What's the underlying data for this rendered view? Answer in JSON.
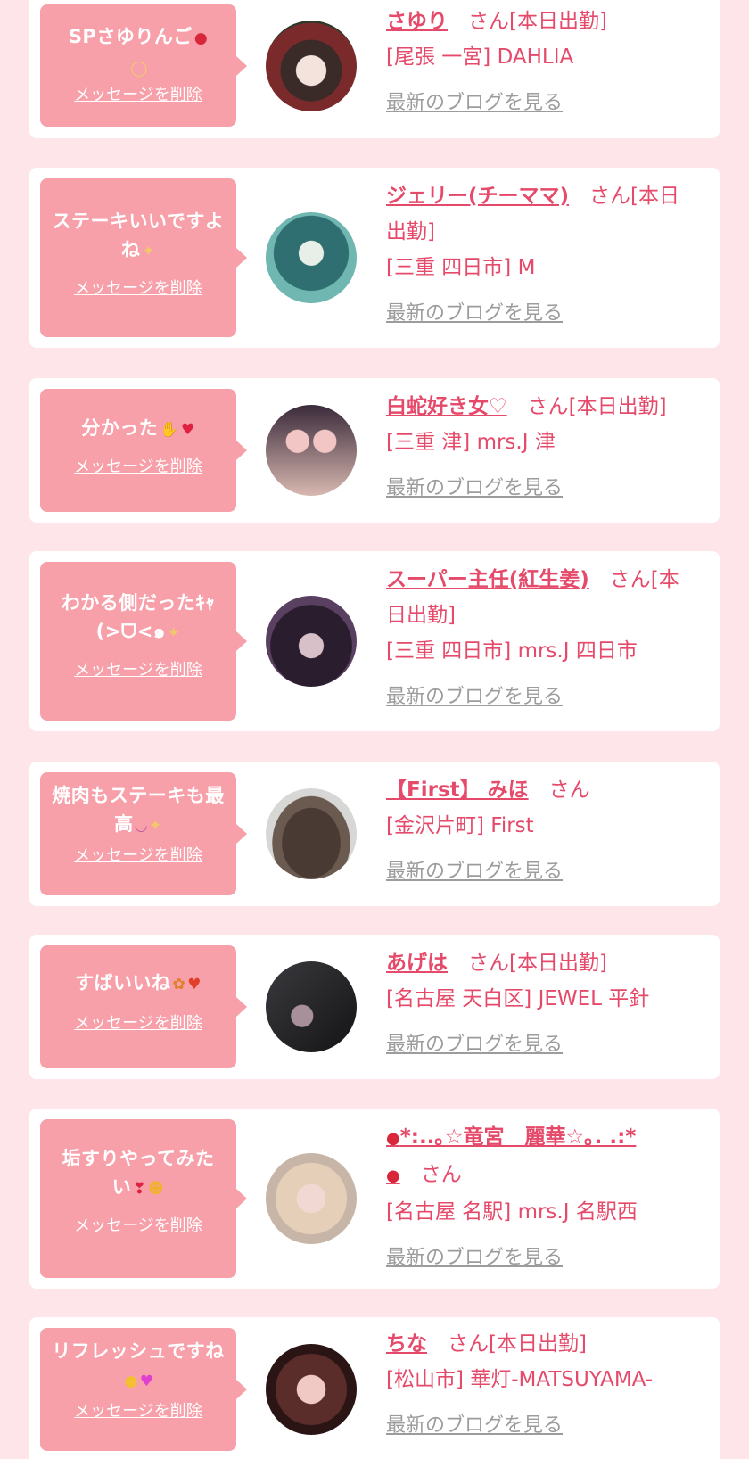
{
  "delete_label": "メッセージを削除",
  "blog_label": "最新のブログを見る",
  "suffix_san": "さん",
  "suffix_san_work": "さん[本日出勤]",
  "colors": {
    "page_bg": "#fde5ea",
    "card_bg": "#ffffff",
    "bubble_bg": "#f7a0aa",
    "accent": "#e54a6a",
    "link_gray": "#9c9c9c"
  },
  "entries": [
    {
      "message": "SPさゆりんご",
      "message_icons": [
        "apple-icon",
        "halo-icon"
      ],
      "name": "さゆり",
      "shop": "[尾張 一宮] DAHLIA"
    },
    {
      "message": "ステーキいいですよね",
      "message_icons": [
        "sparkle-icon"
      ],
      "name": "ジェリー(チーママ)",
      "shop": "[三重 四日市] M"
    },
    {
      "message": "分かった",
      "message_icons": [
        "ok-hand-icon",
        "heart-icon"
      ],
      "name": "白蛇好き女♡",
      "shop": "[三重 津] mrs.J 津"
    },
    {
      "message": "わかる側だったｷｬ(>ᗜ<๑",
      "message_icons": [
        "sparkle-icon"
      ],
      "name": "スーパー主任(紅生姜)",
      "shop": "[三重 四日市] mrs.J 四日市"
    },
    {
      "message": "焼肉もステーキも最高",
      "message_icons": [
        "smile-icon",
        "sparkle-icon"
      ],
      "name": "【First】 みほ",
      "shop": "[金沢片町] First"
    },
    {
      "message": "すばいいね",
      "message_icons": [
        "butterfly-icon",
        "fire-heart-icon"
      ],
      "name": "あげは",
      "shop": "[名古屋 天白区] JEWEL 平針"
    },
    {
      "message": "垢すりやってみたい",
      "message_icons": [
        "heart-exclamation-icon",
        "smiling-hearts-icon"
      ],
      "name": "*:..｡☆竜宮　麗華☆｡. .:*",
      "name_icons": [
        "strawberry-icon",
        "strawberry-icon"
      ],
      "shop": "[名古屋 名駅] mrs.J 名駅西"
    },
    {
      "message": "リフレッシュですね",
      "message_icons": [
        "pleading-face-icon",
        "sparkling-heart-icon"
      ],
      "name": "ちな",
      "shop": "[松山市] 華灯-MATSUYAMA-"
    }
  ]
}
